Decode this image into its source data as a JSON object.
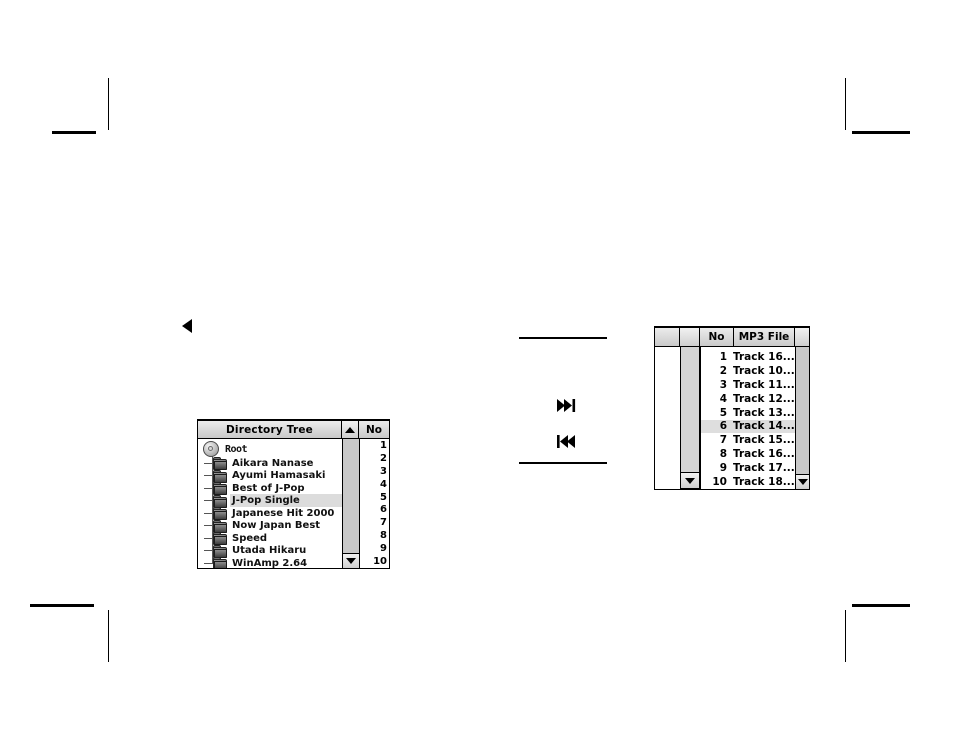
{
  "page": {
    "background_color": "#ffffff",
    "mark_color": "#000000"
  },
  "crop_marks": {
    "label": "printer crop marks",
    "corners": [
      "top-left",
      "top-right",
      "bottom-left",
      "bottom-right"
    ]
  },
  "pointer_marker": {
    "name": "left-triangle-marker",
    "glyph": "◀"
  },
  "directory_tree_window": {
    "title": "Directory Tree",
    "root": {
      "label": "Root",
      "icon": "disc-icon"
    },
    "items": [
      {
        "label": "Aikara Nanase",
        "icon": "folder-icon",
        "selected": false
      },
      {
        "label": "Ayumi Hamasaki",
        "icon": "folder-icon",
        "selected": false
      },
      {
        "label": "Best of J-Pop",
        "icon": "folder-icon",
        "selected": false
      },
      {
        "label": "J-Pop Single",
        "icon": "folder-icon",
        "selected": true
      },
      {
        "label": "Japanese Hit 2000",
        "icon": "folder-icon",
        "selected": false
      },
      {
        "label": "Now Japan Best",
        "icon": "folder-icon",
        "selected": false
      },
      {
        "label": "Speed",
        "icon": "folder-icon",
        "selected": false
      },
      {
        "label": "Utada Hikaru",
        "icon": "folder-icon",
        "selected": false
      },
      {
        "label": "WinAmp 2.64",
        "icon": "folder-icon",
        "selected": false
      }
    ],
    "scroll_up_glyph": "▲",
    "scroll_down_glyph": "▼",
    "clipped_column_header": "No",
    "clipped_numbers": [
      "1",
      "2",
      "3",
      "4",
      "5",
      "6",
      "7",
      "8",
      "9",
      "10"
    ],
    "highlight_color": "#dcdcdc",
    "header_color": "#d8d8d8"
  },
  "transport_callout": {
    "next_track": {
      "name": "next-track-icon",
      "glyph": "⏭"
    },
    "previous_track": {
      "name": "previous-track-icon",
      "glyph": "⏮"
    }
  },
  "mp3_window": {
    "columns": [
      "No",
      "MP3 File"
    ],
    "scroll_up_glyph": "▲",
    "scroll_down_glyph": "▼",
    "highlight_color": "#dedede",
    "rows": [
      {
        "no": "1",
        "file": "Track 16......",
        "selected": false
      },
      {
        "no": "2",
        "file": "Track 10......",
        "selected": false
      },
      {
        "no": "3",
        "file": "Track 11......",
        "selected": false
      },
      {
        "no": "4",
        "file": "Track 12......",
        "selected": false
      },
      {
        "no": "5",
        "file": "Track 13......",
        "selected": false
      },
      {
        "no": "6",
        "file": "Track 14......",
        "selected": true
      },
      {
        "no": "7",
        "file": "Track 15......",
        "selected": false
      },
      {
        "no": "8",
        "file": "Track 16......",
        "selected": false
      },
      {
        "no": "9",
        "file": "Track 17......",
        "selected": false
      },
      {
        "no": "10",
        "file": "Track 18......",
        "selected": false
      }
    ]
  }
}
